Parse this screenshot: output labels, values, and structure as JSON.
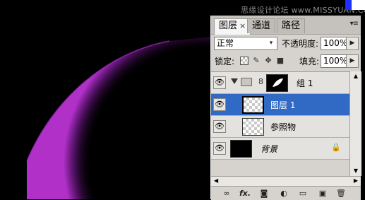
{
  "watermark": "思缘设计论坛 www.MISSYUAN.COM",
  "tabs": [
    {
      "label": "图层",
      "close": "×"
    },
    {
      "label": "通道"
    },
    {
      "label": "路径"
    }
  ],
  "menu_icon": "▾≡",
  "blend_mode": {
    "value": "正常",
    "dropdown": "▾"
  },
  "opacity": {
    "label": "不透明度:",
    "value": "100%"
  },
  "lock": {
    "label": "锁定:"
  },
  "fill": {
    "label": "填充:",
    "value": "100%"
  },
  "arrow": "▶",
  "layers": [
    {
      "name": "组 1",
      "type": "group"
    },
    {
      "name": "图层 1",
      "selected": true
    },
    {
      "name": "参照物"
    },
    {
      "name": "背景",
      "locked": true
    }
  ],
  "icons": {
    "eye": "👁",
    "chain": "8",
    "lock": "🔒",
    "link": "∞",
    "fx": "fx.",
    "mask": "◙",
    "adjust": "◐",
    "folder": "▭",
    "new": "▣",
    "trash": "🗑",
    "up": "▲",
    "down": "▼",
    "left": "◀",
    "right": "▶"
  },
  "colors": {
    "panel_bg": "#d6d3ce",
    "selected": "#316ac5",
    "glow": "#8a1fa0"
  }
}
